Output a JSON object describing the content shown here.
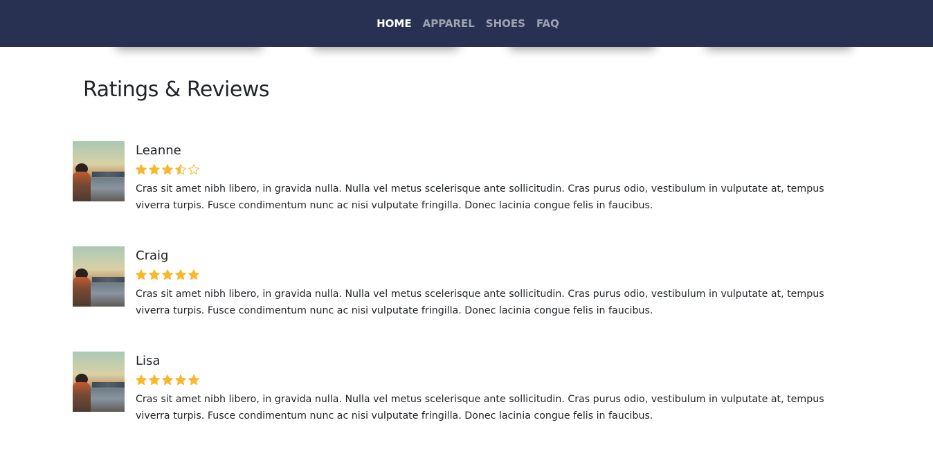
{
  "nav": {
    "items": [
      {
        "label": "HOME",
        "active": true
      },
      {
        "label": "APPAREL",
        "active": false
      },
      {
        "label": "SHOES",
        "active": false
      },
      {
        "label": "FAQ",
        "active": false
      }
    ]
  },
  "colors": {
    "navbar_bg": "#283152",
    "star": "#f8b82a",
    "text": "#212529"
  },
  "section": {
    "title": "Ratings & Reviews"
  },
  "reviews": [
    {
      "name": "Leanne",
      "rating": 3.5,
      "max_rating": 5,
      "text": "Cras sit amet nibh libero, in gravida nulla. Nulla vel metus scelerisque ante sollicitudin. Cras purus odio, vestibulum in vulputate at, tempus viverra turpis. Fusce condimentum nunc ac nisi vulputate fringilla. Donec lacinia congue felis in faucibus."
    },
    {
      "name": "Craig",
      "rating": 5,
      "max_rating": 5,
      "text": "Cras sit amet nibh libero, in gravida nulla. Nulla vel metus scelerisque ante sollicitudin. Cras purus odio, vestibulum in vulputate at, tempus viverra turpis. Fusce condimentum nunc ac nisi vulputate fringilla. Donec lacinia congue felis in faucibus."
    },
    {
      "name": "Lisa",
      "rating": 5,
      "max_rating": 5,
      "text": "Cras sit amet nibh libero, in gravida nulla. Nulla vel metus scelerisque ante sollicitudin. Cras purus odio, vestibulum in vulputate at, tempus viverra turpis. Fusce condimentum nunc ac nisi vulputate fringilla. Donec lacinia congue felis in faucibus."
    }
  ]
}
